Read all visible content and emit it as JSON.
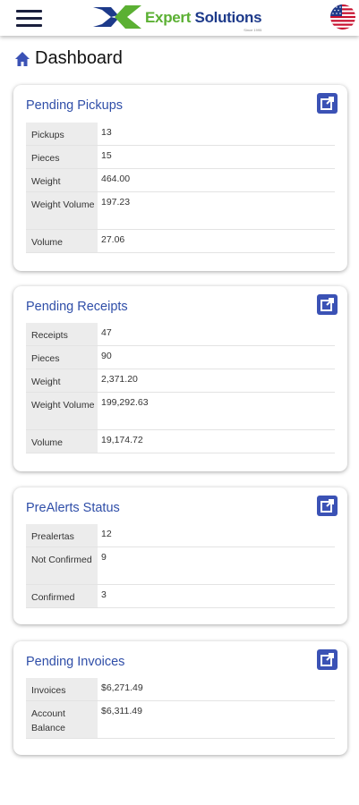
{
  "header": {
    "logo_word1": "Expert",
    "logo_word2": "Solutions",
    "logo_sub": "Since 1995"
  },
  "page": {
    "title": "Dashboard"
  },
  "cards": [
    {
      "title": "Pending Pickups",
      "rows": [
        {
          "label": "Pickups",
          "value": "13"
        },
        {
          "label": "Pieces",
          "value": "15"
        },
        {
          "label": "Weight",
          "value": "464.00"
        },
        {
          "label": "Weight Volume",
          "value": "197.23"
        },
        {
          "label": "Volume",
          "value": "27.06"
        }
      ]
    },
    {
      "title": "Pending Receipts",
      "rows": [
        {
          "label": "Receipts",
          "value": "47"
        },
        {
          "label": "Pieces",
          "value": "90"
        },
        {
          "label": "Weight",
          "value": "2,371.20"
        },
        {
          "label": "Weight Volume",
          "value": "199,292.63"
        },
        {
          "label": "Volume",
          "value": "19,174.72"
        }
      ]
    },
    {
      "title": "PreAlerts Status",
      "rows": [
        {
          "label": "Prealertas",
          "value": "12"
        },
        {
          "label": "Not Confirmed",
          "value": "9"
        },
        {
          "label": "Confirmed",
          "value": "3"
        }
      ]
    },
    {
      "title": "Pending Invoices",
      "rows": [
        {
          "label": "Invoices",
          "value": "$6,271.49"
        },
        {
          "label": "Account Balance",
          "value": "$6,311.49"
        }
      ]
    }
  ],
  "colors": {
    "accent": "#3b52b5",
    "title_blue": "#2f4ea8",
    "logo_green": "#5bb033",
    "logo_navy": "#1d3a8a"
  }
}
